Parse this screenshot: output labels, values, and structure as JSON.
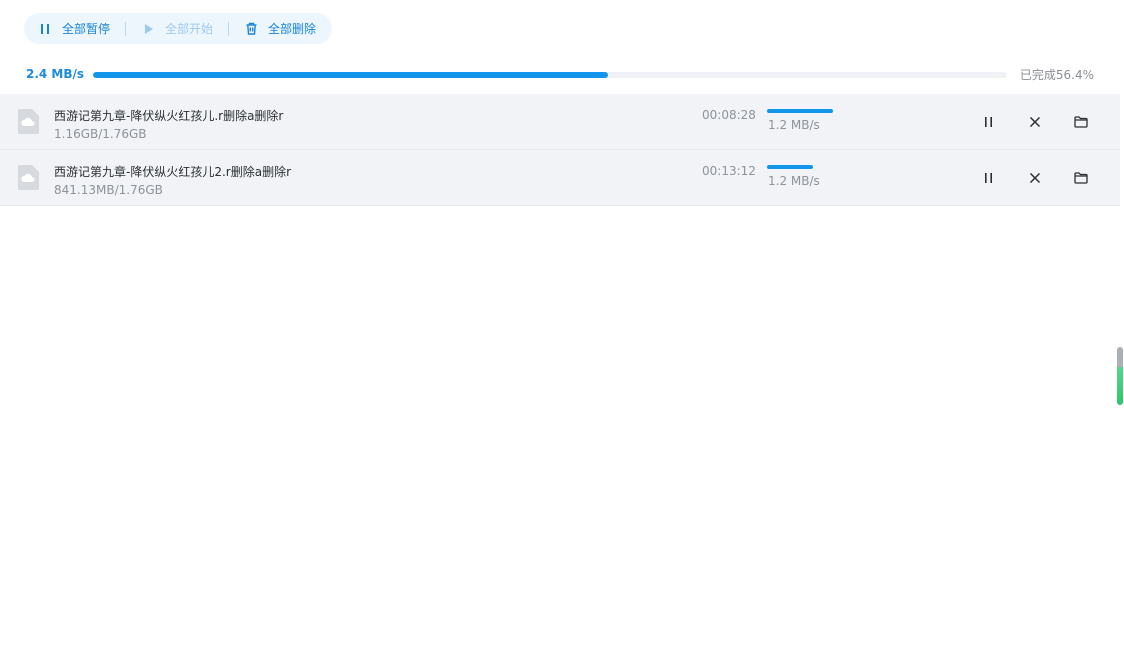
{
  "toolbar": {
    "pause_all": "全部暂停",
    "start_all": "全部开始",
    "delete_all": "全部删除"
  },
  "total": {
    "speed": "2.4 MB/s",
    "status": "已完成56.4%",
    "progress": 0.564
  },
  "downloads": [
    {
      "name": "西游记第九章-降伏纵火红孩儿.r删除a删除r",
      "size": "1.16GB/1.76GB",
      "time_left": "00:08:28",
      "speed": "1.2 MB/s",
      "progress": 0.66
    },
    {
      "name": "西游记第九章-降伏纵火红孩儿2.r删除a删除r",
      "size": "841.13MB/1.76GB",
      "time_left": "00:13:12",
      "speed": "1.2 MB/s",
      "progress": 0.46
    }
  ],
  "colors": {
    "accent": "#1296ec",
    "row_bg": "#f1f3f6",
    "muted_text": "#8d939a"
  },
  "icons": {
    "pause_all": "pause-icon",
    "start_all": "play-icon",
    "delete_all": "trash-icon",
    "file": "file-icon",
    "row_pause": "pause-icon",
    "row_cancel": "close-icon",
    "row_folder": "folder-icon"
  }
}
